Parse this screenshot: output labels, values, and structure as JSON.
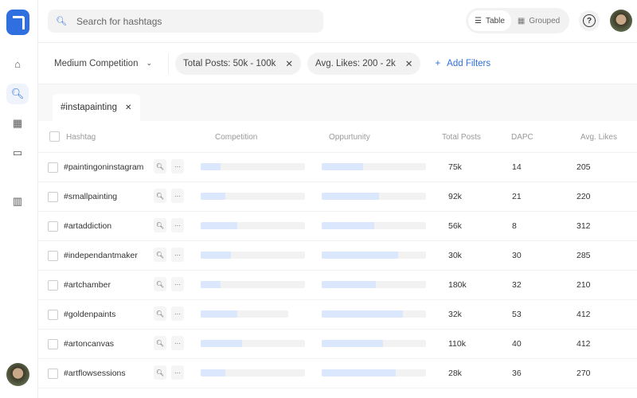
{
  "search": {
    "placeholder": "Search for hashtags"
  },
  "view_toggle": {
    "table": "Table",
    "grouped": "Grouped",
    "active": "Table"
  },
  "filters": {
    "dropdown": "Medium Competition",
    "chips": [
      "Total Posts: 50k - 100k",
      "Avg. Likes: 200 - 2k"
    ],
    "add": "Add Filters"
  },
  "tabs": [
    {
      "label": "#instapainting"
    }
  ],
  "columns": [
    "Hashtag",
    "Competition",
    "Oppurtunity",
    "Total Posts",
    "DAPC",
    "Avg. Likes"
  ],
  "colors": {
    "accent": "#2f6fe0",
    "bar_fill": "#dbe7fc",
    "bar_track": "#f2f2f2"
  },
  "rows": [
    {
      "hashtag": "#paintingoninstagram",
      "competition": 19,
      "opportunity": 40,
      "total_posts": "75k",
      "dapc": "14",
      "avg_likes": "205"
    },
    {
      "hashtag": "#smallpainting",
      "competition": 24,
      "opportunity": 55,
      "total_posts": "92k",
      "dapc": "21",
      "avg_likes": "220"
    },
    {
      "hashtag": "#artaddiction",
      "competition": 35,
      "opportunity": 50,
      "total_posts": "56k",
      "dapc": "8",
      "avg_likes": "312"
    },
    {
      "hashtag": "#independantmaker",
      "competition": 29,
      "opportunity": 73,
      "total_posts": "30k",
      "dapc": "30",
      "avg_likes": "285"
    },
    {
      "hashtag": "#artchamber",
      "competition": 19,
      "opportunity": 52,
      "total_posts": "180k",
      "dapc": "32",
      "avg_likes": "210"
    },
    {
      "hashtag": "#goldenpaints",
      "competition": 35,
      "opportunity": 78,
      "total_posts": "32k",
      "dapc": "53",
      "avg_likes": "412"
    },
    {
      "hashtag": "#artoncanvas",
      "competition": 40,
      "opportunity": 59,
      "total_posts": "110k",
      "dapc": "40",
      "avg_likes": "412"
    },
    {
      "hashtag": "#artflowsessions",
      "competition": 24,
      "opportunity": 71,
      "total_posts": "28k",
      "dapc": "36",
      "avg_likes": "270"
    }
  ]
}
